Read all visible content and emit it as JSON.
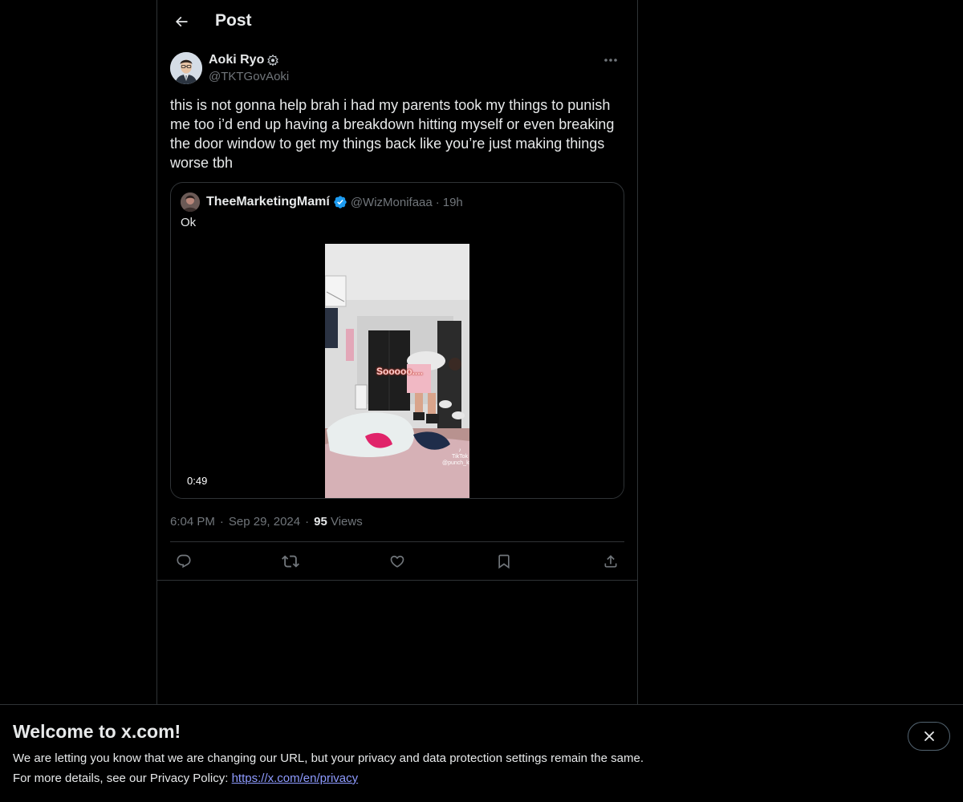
{
  "header": {
    "title": "Post"
  },
  "post": {
    "author_name": "Aoki Ryo",
    "author_handle": "@TKTGovAoki",
    "text": "this is not gonna help brah i had my parents took my things to punish me too i’d end up having a breakdown hitting myself or even breaking the door window to get my things back like you’re just making things worse tbh",
    "time": "6:04 PM",
    "date": "Sep 29, 2024",
    "views_count": "95",
    "views_label": "Views",
    "separator": "·"
  },
  "quote": {
    "name": "TheeMarketingMamí",
    "handle": "@WizMonifaaa",
    "separator": "·",
    "time": "19h",
    "text": "Ok",
    "video_duration": "0:49",
    "video_overlay_text": "Sooooo....",
    "video_watermark": "TikTok",
    "video_watermark_handle": "@punch_kyck"
  },
  "actions": [
    "reply-icon",
    "repost-icon",
    "like-icon",
    "bookmark-icon",
    "share-icon"
  ],
  "banner": {
    "title": "Welcome to x.com!",
    "line1": "We are letting you know that we are changing our URL, but your privacy and data protection settings remain the same.",
    "line2_prefix": "For more details, see our Privacy Policy: ",
    "link": "https://x.com/en/privacy"
  },
  "colors": {
    "background": "#000000",
    "text": "#e7e9ea",
    "muted": "#71767b",
    "border": "#2f3336",
    "verified_blue": "#1d9bf0",
    "link": "#8e9bff"
  }
}
